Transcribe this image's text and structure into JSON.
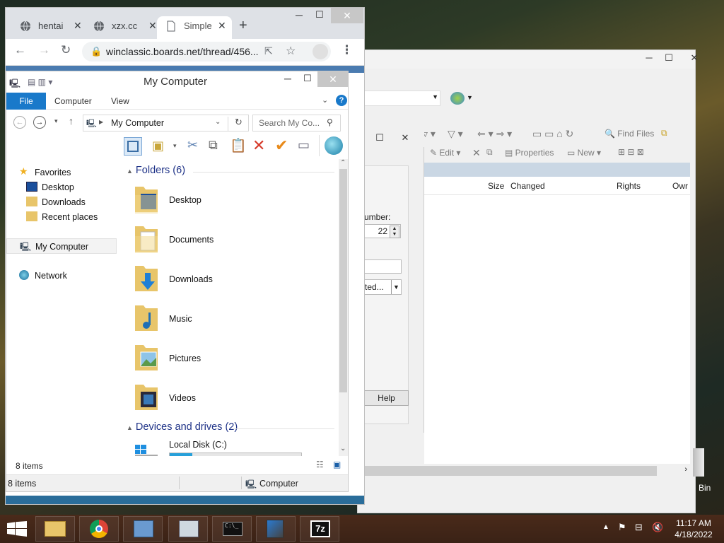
{
  "back_window": {
    "toolbar": {
      "find_files": "Find Files",
      "edit": "Edit",
      "properties": "Properties",
      "new": "New"
    },
    "columns": [
      "Size",
      "Changed",
      "Rights",
      "Owr"
    ],
    "dialog": {
      "port_label": "umber:",
      "port_value": "22",
      "combo_text": "ted...",
      "help_button": "Help"
    },
    "recycle_label": "Bin"
  },
  "chrome": {
    "tabs": [
      {
        "label": "hentai"
      },
      {
        "label": "xzx.cc"
      },
      {
        "label": "Simple"
      }
    ],
    "url": "winclassic.boards.net/thread/456..."
  },
  "explorer": {
    "title": "My Computer",
    "ribbon": {
      "file": "File",
      "tabs": [
        "Computer",
        "View"
      ]
    },
    "address": "My Computer",
    "search_placeholder": "Search My Co...",
    "nav": {
      "favorites": "Favorites",
      "items": [
        "Desktop",
        "Downloads",
        "Recent places"
      ],
      "my_computer": "My Computer",
      "network": "Network"
    },
    "folders_header": "Folders (6)",
    "folders": [
      "Desktop",
      "Documents",
      "Downloads",
      "Music",
      "Pictures",
      "Videos"
    ],
    "drives_header": "Devices and drives (2)",
    "drive": {
      "name": "Local Disk (C:)",
      "used_fraction": 0.17
    },
    "status_items": "8 items",
    "status2_items": "8 items",
    "status2_location": "Computer"
  },
  "taskbar": {
    "time": "11:17 AM",
    "date": "4/18/2022"
  }
}
